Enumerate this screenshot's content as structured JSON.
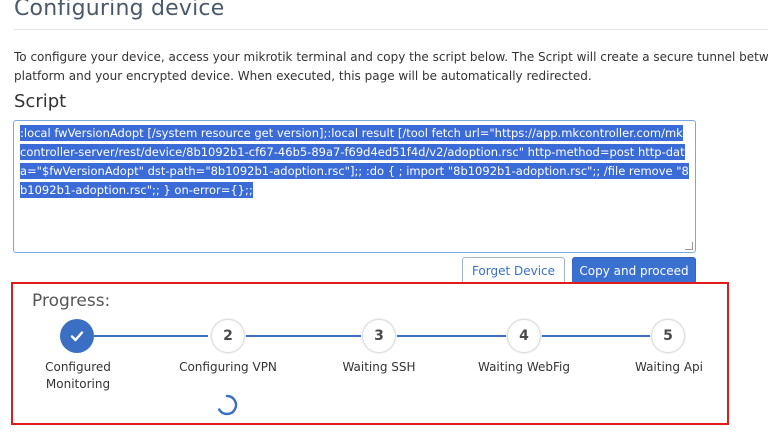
{
  "page": {
    "title": "Configuring device",
    "description_line1": "To configure your device, access your mikrotik terminal and copy the script below. The Script will create a secure tunnel between t",
    "description_line2": "platform and your encrypted device. When executed, this page will be automatically redirected.",
    "script_label": "Script"
  },
  "script": {
    "value": ":local fwVersionAdopt [/system resource get version];:local result [/tool fetch url=\"https://app.mkcontroller.com/mkcontroller-server/rest/device/8b1092b1-cf67-46b5-89a7-f69d4ed51f4d/v2/adoption.rsc\" http-method=post http-data=\"$fwVersionAdopt\" dst-path=\"8b1092b1-adoption.rsc\"];; :do { ; import \"8b1092b1-adoption.rsc\";; /file remove \"8b1092b1-adoption.rsc\";; } on-error={};;",
    "selected": true,
    "selection_color": "#3b6bd6"
  },
  "buttons": {
    "forget_label": "Forget Device",
    "copy_label": "Copy and proceed"
  },
  "progress": {
    "title": "Progress:",
    "current_step": 2,
    "steps": [
      {
        "number": "1",
        "label": "Configured\nMonitoring",
        "status": "done",
        "icon": "check-icon"
      },
      {
        "number": "2",
        "label": "Configuring VPN",
        "status": "active",
        "icon": "spinner-icon"
      },
      {
        "number": "3",
        "label": "Waiting SSH",
        "status": "pending"
      },
      {
        "number": "4",
        "label": "Waiting WebFig",
        "status": "pending"
      },
      {
        "number": "5",
        "label": "Waiting Api",
        "status": "pending"
      }
    ]
  },
  "colors": {
    "accent": "#3a6fc4",
    "highlight_frame": "#e01b1b"
  }
}
